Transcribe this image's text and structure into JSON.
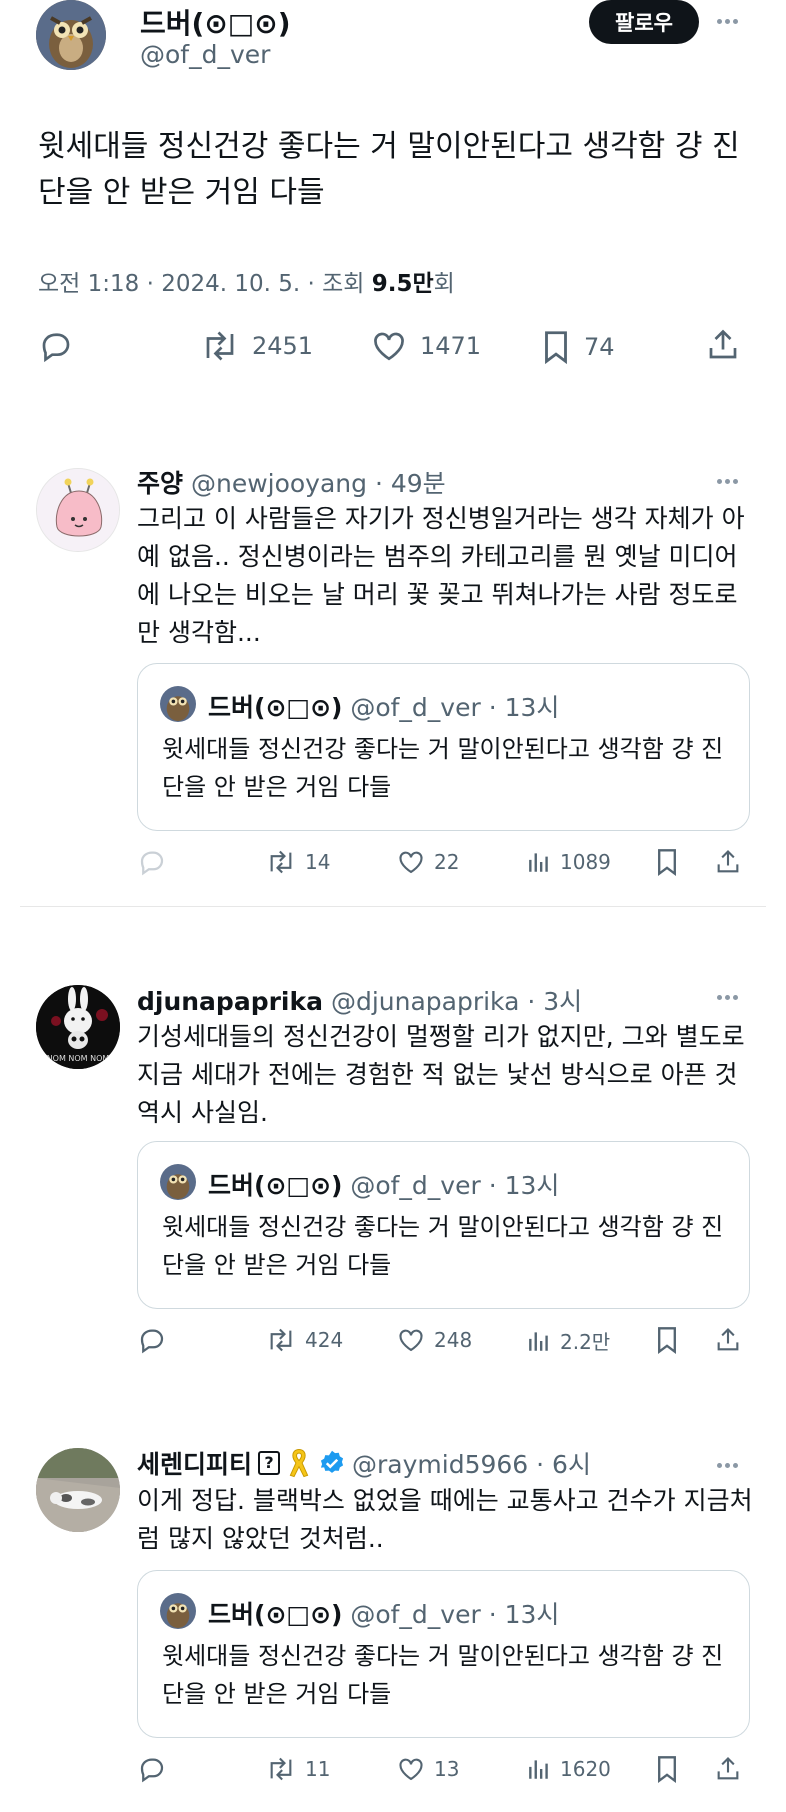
{
  "main_tweet": {
    "author_name": "드버(⊙□⊙)",
    "handle": "@of_d_ver",
    "follow_label": "팔로우",
    "text": "윗세대들 정신건강 좋다는 거 말이안된다고 생각함 걍 진단을 안 받은 거임 다들",
    "meta_prefix": "오전 1:18 · 2024. 10. 5. · 조회 ",
    "views": "9.5만",
    "views_suffix": "회",
    "retweets": "2451",
    "likes": "1471",
    "bookmarks": "74"
  },
  "replies": [
    {
      "name": "주양",
      "handle": "@newjooyang · 49분",
      "text": "그리고 이 사람들은 자기가 정신병일거라는 생각 자체가 아예 없음.. 정신병이라는 범주의 카테고리를 뭔 옛날 미디어에 나오는 비오는 날 머리 꽃 꽂고 뛰쳐나가는 사람 정도로만 생각함...",
      "quote": {
        "name": "드버(⊙□⊙)",
        "handle": "@of_d_ver · 13시",
        "text": "윗세대들 정신건강 좋다는 거 말이안된다고 생각함 걍 진단을 안 받은 거임 다들"
      },
      "retweets": "14",
      "likes": "22",
      "views": "1089"
    },
    {
      "name": "djunapaprika",
      "handle": "@djunapaprika · 3시",
      "text": "기성세대들의 정신건강이 멀쩡할 리가 없지만, 그와 별도로 지금 세대가 전에는 경험한 적 없는 낯선 방식으로 아픈 것 역시 사실임.",
      "quote": {
        "name": "드버(⊙□⊙)",
        "handle": "@of_d_ver · 13시",
        "text": "윗세대들 정신건강 좋다는 거 말이안된다고 생각함 걍 진단을 안 받은 거임 다들"
      },
      "retweets": "424",
      "likes": "248",
      "views": "2.2만"
    },
    {
      "name": "세렌디피티",
      "handle": "@raymid5966 · 6시",
      "text": "이게 정답. 블랙박스 없었을 때에는 교통사고 건수가 지금처럼 많지 않았던 것처럼..",
      "quote": {
        "name": "드버(⊙□⊙)",
        "handle": "@of_d_ver · 13시",
        "text": "윗세대들 정신건강 좋다는 거 말이안된다고 생각함 걍 진단을 안 받은 거임 다들"
      },
      "retweets": "11",
      "likes": "13",
      "views": "1620"
    }
  ],
  "avatar_label": "NOM NOM NOM",
  "colors": {
    "text": "#0f1419",
    "secondary": "#536471",
    "border": "#cfd9de",
    "verified": "#1d9bf0",
    "ribbon": "#f5c518"
  },
  "icons": [
    "reply-icon",
    "retweet-icon",
    "like-icon",
    "bookmark-icon",
    "share-icon",
    "views-icon",
    "more-icon",
    "verified-badge-icon",
    "yellow-ribbon-icon"
  ]
}
